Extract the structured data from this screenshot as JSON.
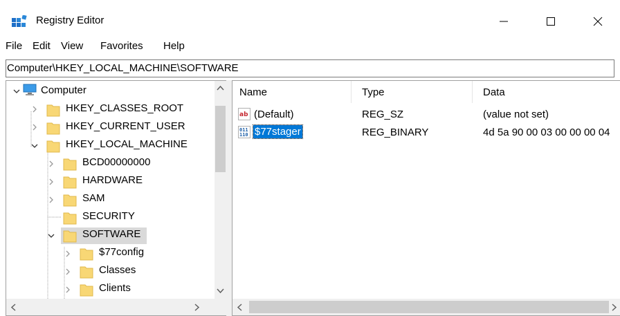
{
  "window": {
    "title": "Registry Editor",
    "minimize_glyph": "—",
    "maximize_glyph": "☐",
    "close_glyph": "✕"
  },
  "menu": [
    "File",
    "Edit",
    "View",
    "Favorites",
    "Help"
  ],
  "address": "Computer\\HKEY_LOCAL_MACHINE\\SOFTWARE",
  "tree": {
    "root": "Computer",
    "hives": [
      "HKEY_CLASSES_ROOT",
      "HKEY_CURRENT_USER",
      "HKEY_LOCAL_MACHINE"
    ],
    "hklm_children": [
      "BCD00000000",
      "HARDWARE",
      "SAM",
      "SECURITY",
      "SOFTWARE"
    ],
    "software_children": [
      "$77config",
      "Classes",
      "Clients"
    ],
    "selected": "SOFTWARE"
  },
  "list": {
    "columns": [
      "Name",
      "Type",
      "Data"
    ],
    "rows": [
      {
        "name": "(Default)",
        "type": "REG_SZ",
        "data": "(value not set)",
        "icon": "string-value-icon"
      },
      {
        "name": "$77stager",
        "type": "REG_BINARY",
        "data": "4d 5a 90 00 03 00 00 00 04",
        "icon": "binary-value-icon"
      }
    ],
    "selected": "$77stager"
  },
  "colors": {
    "selection_blue": "#0078d7",
    "tree_selection": "#d9d9d9",
    "folder_yellow": "#f8d775",
    "border": "#a0a0a0"
  }
}
